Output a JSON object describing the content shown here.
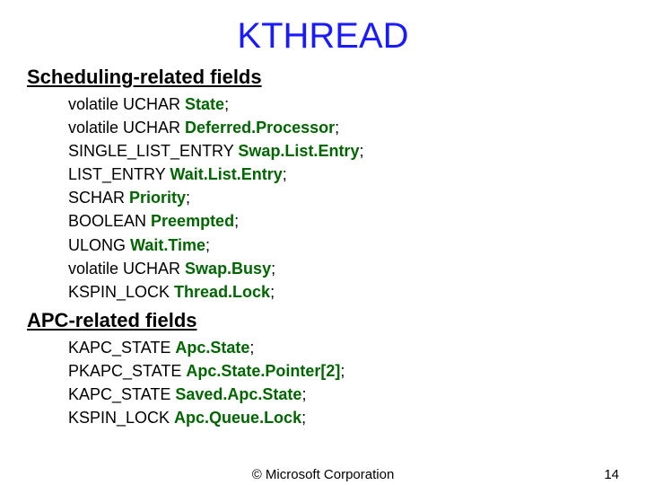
{
  "title": "KTHREAD",
  "sections": [
    {
      "heading": "Scheduling-related fields",
      "fields": [
        {
          "type": "volatile UCHAR ",
          "name": "State"
        },
        {
          "type": "volatile UCHAR ",
          "name": "Deferred.Processor"
        },
        {
          "type": "SINGLE_LIST_ENTRY ",
          "name": "Swap.List.Entry"
        },
        {
          "type": "LIST_ENTRY ",
          "name": "Wait.List.Entry"
        },
        {
          "type": "SCHAR ",
          "name": "Priority"
        },
        {
          "type": "BOOLEAN ",
          "name": "Preempted"
        },
        {
          "type": "ULONG ",
          "name": "Wait.Time"
        },
        {
          "type": "volatile UCHAR ",
          "name": "Swap.Busy"
        },
        {
          "type": "KSPIN_LOCK ",
          "name": "Thread.Lock"
        }
      ]
    },
    {
      "heading": "APC-related fields",
      "fields": [
        {
          "type": "KAPC_STATE ",
          "name": "Apc.State"
        },
        {
          "type": "PKAPC_STATE ",
          "name": "Apc.State.Pointer[2]"
        },
        {
          "type": "KAPC_STATE ",
          "name": "Saved.Apc.State"
        },
        {
          "type": "KSPIN_LOCK ",
          "name": "Apc.Queue.Lock"
        }
      ]
    }
  ],
  "footer": {
    "copyright": "© Microsoft Corporation",
    "page": "14"
  }
}
